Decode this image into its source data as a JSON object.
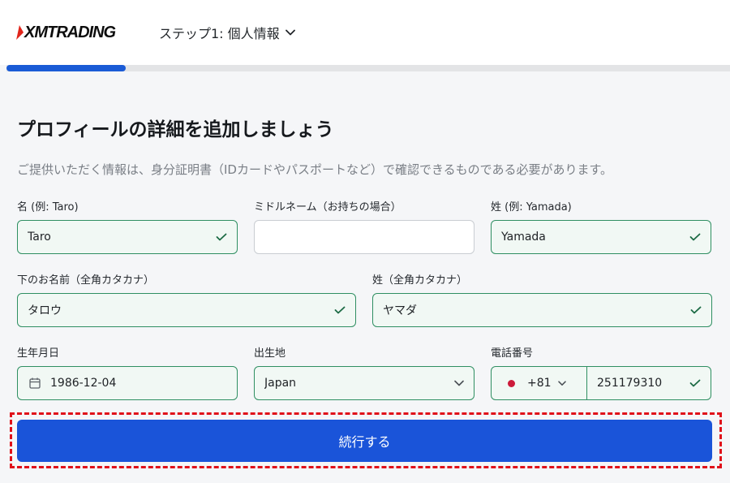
{
  "brand": {
    "logo_text": "XMTRADING",
    "accent_color": "#1a54d9",
    "logo_mark_color": "#e1251b"
  },
  "header": {
    "step_label": "ステップ1: 個人情報",
    "step_icon": "chevron-down-icon"
  },
  "progress": {
    "fraction": 0.165,
    "color": "#1a5bd6"
  },
  "page": {
    "title": "プロフィールの詳細を追加しましょう",
    "subtitle": "ご提供いただく情報は、身分証明書（IDカードやパスポートなど）で確認できるものである必要があります。"
  },
  "form": {
    "first_name": {
      "label": "名 (例: Taro)",
      "value": "Taro",
      "state": "valid"
    },
    "middle_name": {
      "label": "ミドルネーム（お持ちの場合）",
      "value": "",
      "state": "empty"
    },
    "last_name": {
      "label": "姓 (例: Yamada)",
      "value": "Yamada",
      "state": "valid"
    },
    "first_name_kana": {
      "label": "下のお名前（全角カタカナ）",
      "value": "タロウ",
      "state": "valid"
    },
    "last_name_kana": {
      "label": "姓（全角カタカナ）",
      "value": "ヤマダ",
      "state": "valid"
    },
    "birth_date": {
      "label": "生年月日",
      "value": "1986-12-04",
      "icon": "calendar-icon"
    },
    "birth_place": {
      "label": "出生地",
      "value": "Japan",
      "icon": "chevron-down-icon"
    },
    "phone": {
      "label": "電話番号",
      "country_code": "+81",
      "flag": "japan-flag-icon",
      "number": "251179310",
      "state": "valid"
    }
  },
  "status_color": "#2f8f62",
  "submit": {
    "label": "続行する",
    "highlight_color": "#e0111a"
  }
}
